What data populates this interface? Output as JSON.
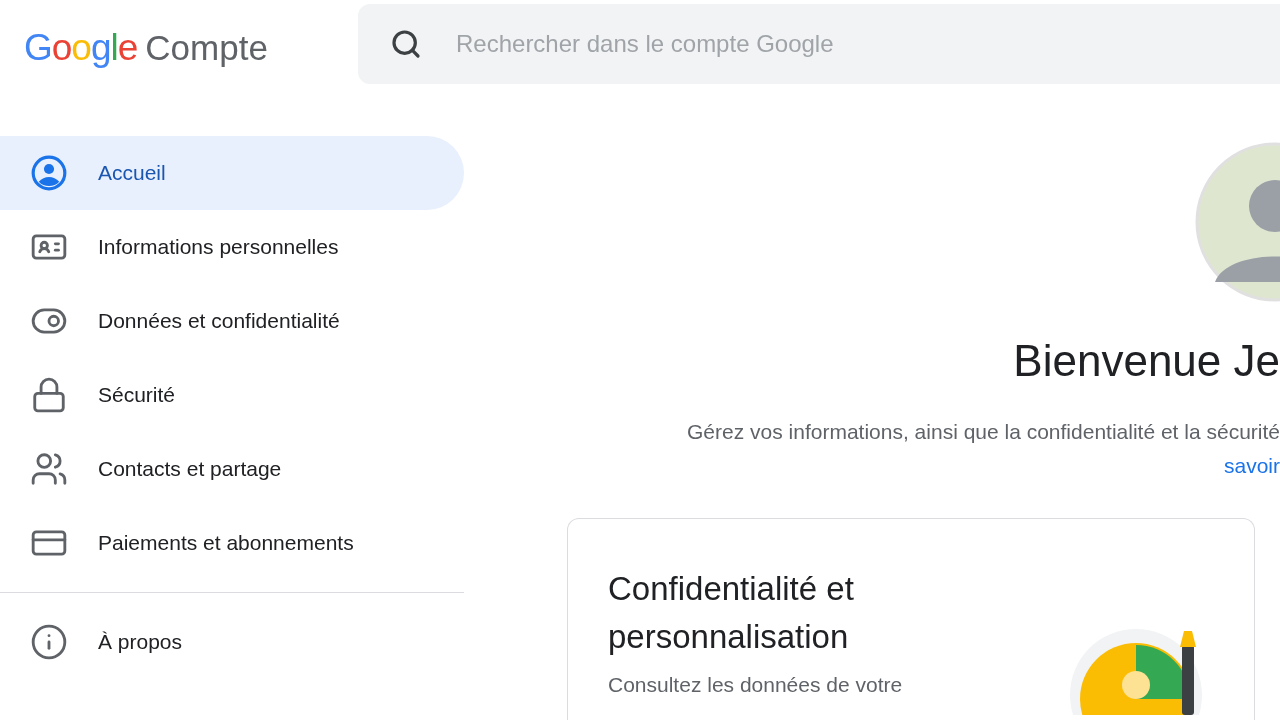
{
  "header": {
    "logo": "Google",
    "product": "Compte",
    "search": {
      "placeholder": "Rechercher dans le compte Google"
    }
  },
  "sidebar": {
    "items": [
      {
        "label": "Accueil",
        "selected": true
      },
      {
        "label": "Informations personnelles",
        "selected": false
      },
      {
        "label": "Données et confidentialité",
        "selected": false
      },
      {
        "label": "Sécurité",
        "selected": false
      },
      {
        "label": "Contacts et partage",
        "selected": false
      },
      {
        "label": "Paiements et abonnements",
        "selected": false
      }
    ],
    "footer_items": [
      {
        "label": "À propos",
        "selected": false
      }
    ]
  },
  "main": {
    "heading": "Bienvenue Je",
    "description": "Gérez vos informations, ainsi que la confidentialité et la sécurité",
    "link": "savoir",
    "card": {
      "title": "Confidentialité et personnalisation",
      "body": "Consultez les données de votre"
    }
  }
}
